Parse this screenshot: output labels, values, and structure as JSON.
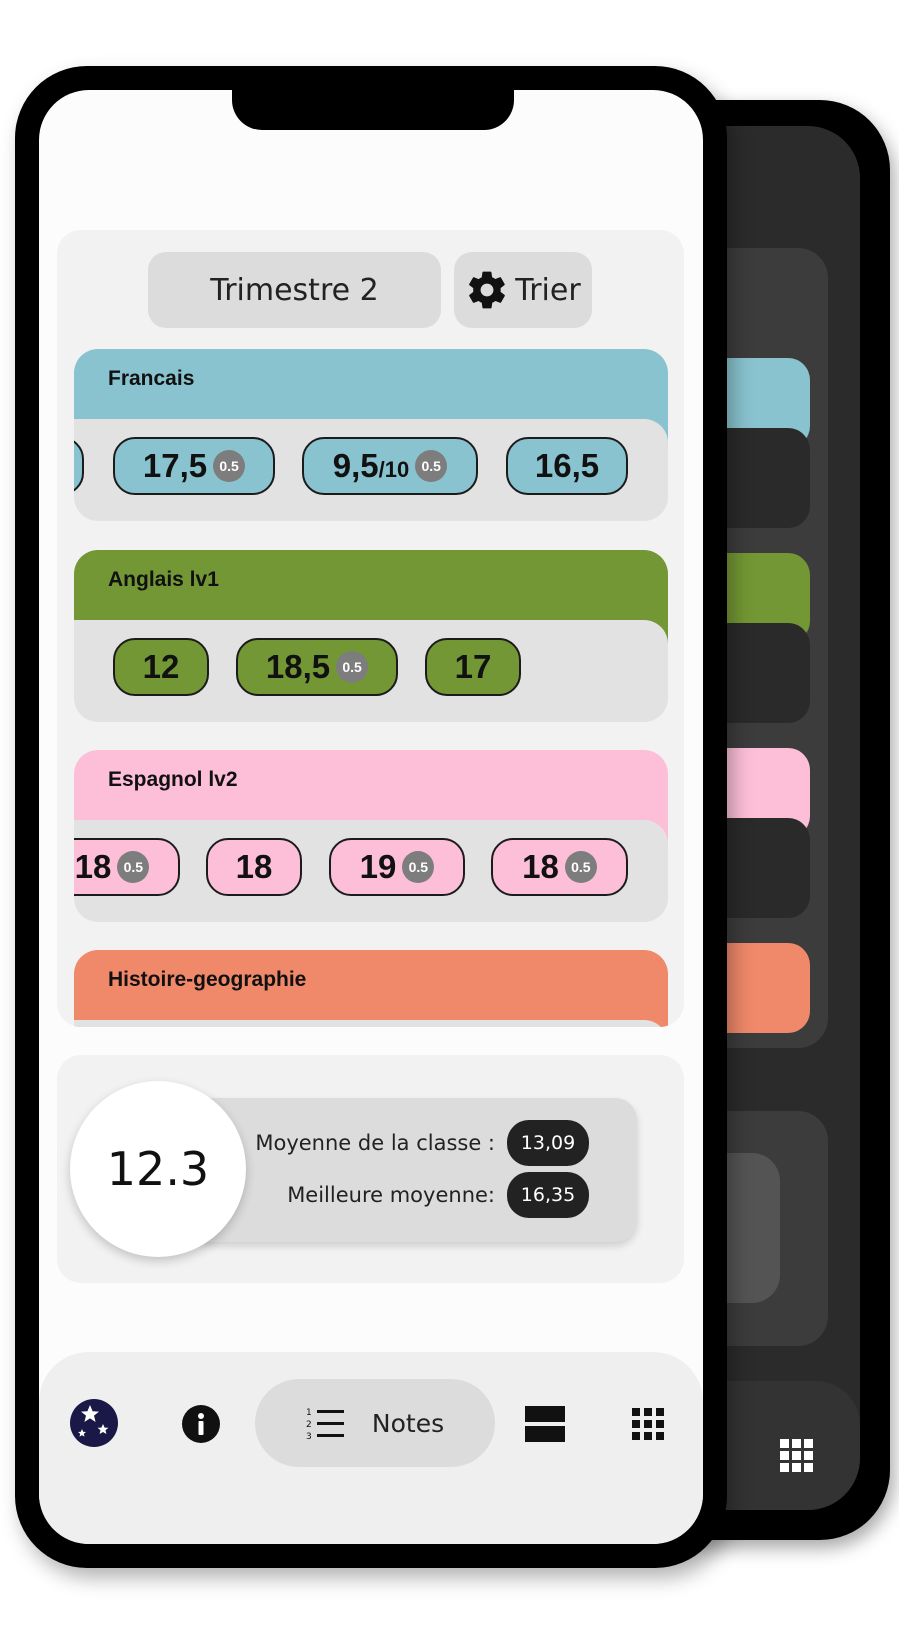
{
  "header": {
    "trimester_label": "Trimestre 2",
    "sort_label": "Trier"
  },
  "subjects": [
    {
      "name": "Francais",
      "color": "#89c3cf",
      "grades": [
        {
          "value": "",
          "suffix": "",
          "coef": ""
        },
        {
          "value": "17,5",
          "suffix": "",
          "coef": "0.5"
        },
        {
          "value": "9,5",
          "suffix": "/10",
          "coef": "0.5"
        },
        {
          "value": "16,5",
          "suffix": "",
          "coef": ""
        }
      ]
    },
    {
      "name": "Anglais lv1",
      "color": "#739734",
      "grades": [
        {
          "value": "12",
          "suffix": "",
          "coef": ""
        },
        {
          "value": "18,5",
          "suffix": "",
          "coef": "0.5"
        },
        {
          "value": "17",
          "suffix": "",
          "coef": ""
        }
      ]
    },
    {
      "name": "Espagnol lv2",
      "color": "#fdbfd8",
      "grades": [
        {
          "value": "18",
          "suffix": "",
          "coef": "0.5"
        },
        {
          "value": "18",
          "suffix": "",
          "coef": ""
        },
        {
          "value": "19",
          "suffix": "",
          "coef": "0.5"
        },
        {
          "value": "18",
          "suffix": "",
          "coef": "0.5"
        }
      ]
    },
    {
      "name": "Histoire-geographie",
      "color": "#f0886a",
      "grades": []
    }
  ],
  "averages": {
    "student_average": "12.3",
    "class_average_label": "Moyenne de la classe :",
    "class_average_value": "13,09",
    "best_average_label": "Meilleure moyenne:",
    "best_average_value": "16,35"
  },
  "nav": {
    "notes_label": "Notes",
    "items": [
      "profile-icon",
      "info-icon",
      "list-numbered-icon",
      "layout-rows-icon",
      "grid-icon"
    ]
  }
}
